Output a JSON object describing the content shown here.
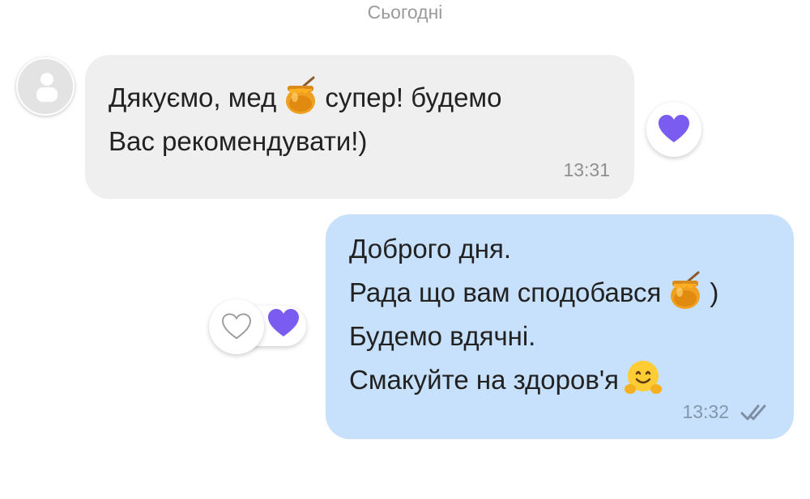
{
  "chat": {
    "date_separator": "Сьогодні",
    "incoming": {
      "line1_part1": "Дякуємо, мед",
      "line1_part2": "супер! будемо",
      "line2": "Вас рекомендувати!)",
      "time": "13:31",
      "reaction_icon": "purple-heart",
      "avatar_icon": "person-placeholder"
    },
    "outgoing": {
      "line1": "Доброго дня.",
      "line2_part1": "Рада що вам сподобався",
      "line2_part2": ")",
      "line3": "Будемо вдячні.",
      "line4": "Смакуйте на здоров'я",
      "time": "13:32",
      "status_icon": "double-check",
      "reaction_icon": "purple-heart",
      "add_reaction_icon": "heart-outline"
    },
    "colors": {
      "incoming_bubble": "#efefef",
      "outgoing_bubble": "#c7e0fc",
      "heart": "#7b5cf0",
      "timestamp": "#8f8f8f"
    }
  }
}
